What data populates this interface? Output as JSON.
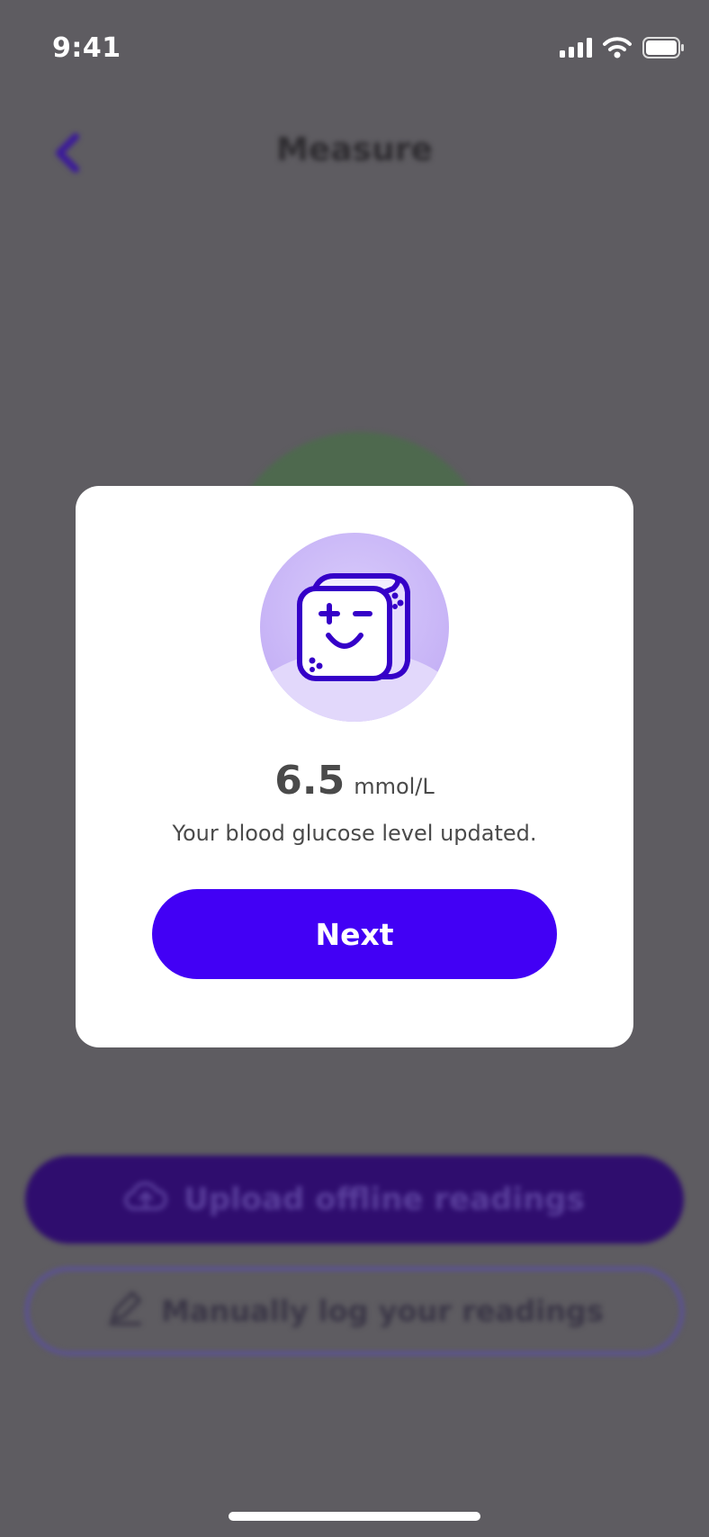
{
  "status_bar": {
    "time": "9:41",
    "icons": [
      "signal-icon",
      "wifi-icon",
      "battery-icon"
    ]
  },
  "background_screen": {
    "nav_title": "Measure",
    "upload_label": "Upload offline readings",
    "manual_label": "Manually log your readings"
  },
  "modal": {
    "reading_value": "6.5",
    "reading_unit": "mmol/L",
    "message": "Your blood glucose level updated.",
    "next_label": "Next",
    "mascot_icon": "winking-sugar-cube-icon"
  },
  "colors": {
    "accent": "#4200f5",
    "overlay": "#5e5c61",
    "modal_background": "#ffffff"
  }
}
